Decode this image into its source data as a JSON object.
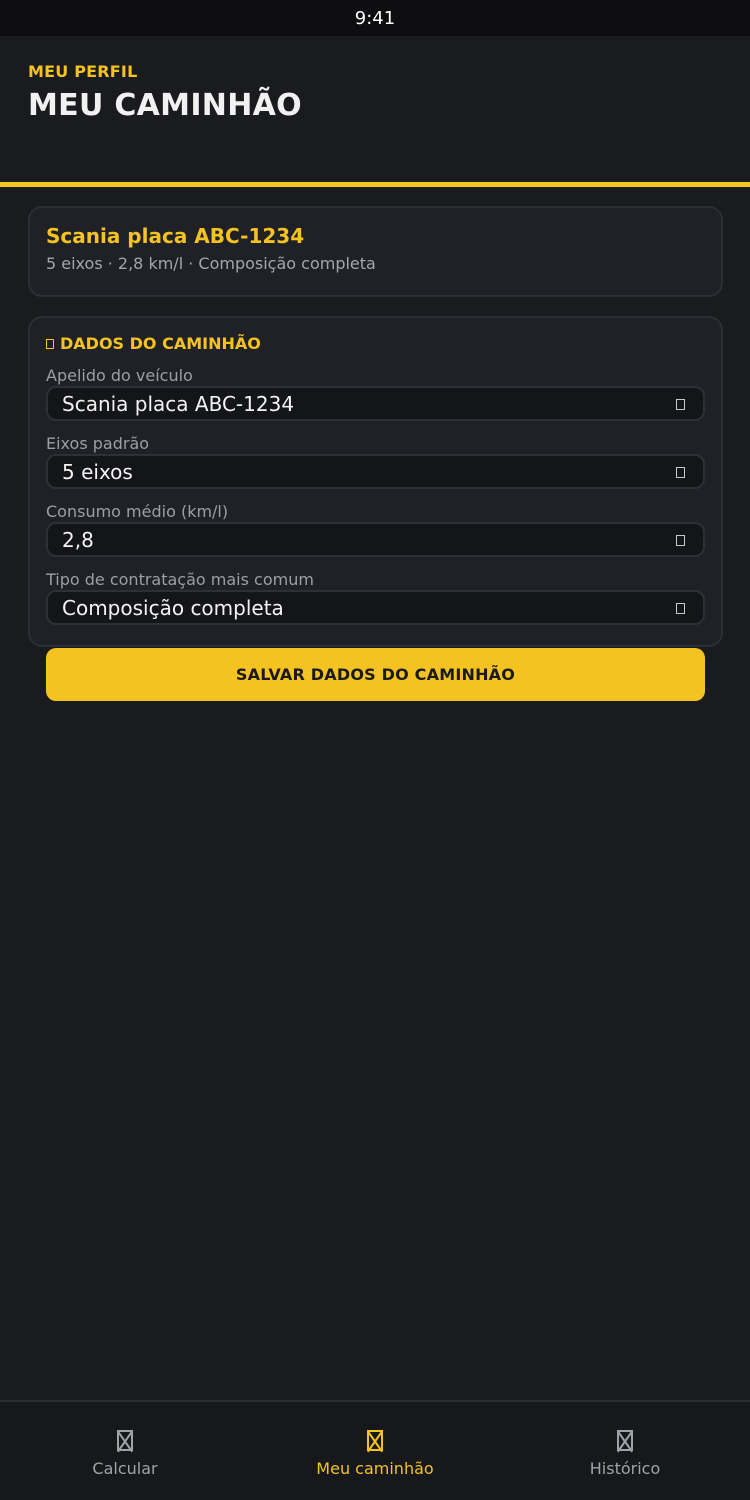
{
  "status_bar": {
    "time": "9:41"
  },
  "header": {
    "eyebrow": "MEU PERFIL",
    "title": "MEU CAMINHÃO"
  },
  "summary": {
    "vehicle_name": "Scania placa ABC-1234",
    "vehicle_meta": "5 eixos · 2,8 km/l · Composição completa"
  },
  "form": {
    "section_title": "DADOS DO CAMINHÃO",
    "fields": [
      {
        "label": "Apelido do veículo",
        "value": "Scania placa ABC-1234"
      },
      {
        "label": "Eixos padrão",
        "value": "5 eixos"
      },
      {
        "label": "Consumo médio (km/l)",
        "value": "2,8"
      },
      {
        "label": "Tipo de contratação mais comum",
        "value": "Composição completa"
      }
    ],
    "save_label": "SALVAR DADOS DO CAMINHÃO"
  },
  "bottom_nav": {
    "items": [
      {
        "label": "Calcular",
        "icon": "calculator-icon",
        "active": false
      },
      {
        "label": "Meu caminhão",
        "icon": "truck-icon",
        "active": true
      },
      {
        "label": "Histórico",
        "icon": "history-icon",
        "active": false
      }
    ]
  },
  "colors": {
    "accent": "#f4c221",
    "background": "#1a1b1f",
    "card": "#1f2126"
  }
}
